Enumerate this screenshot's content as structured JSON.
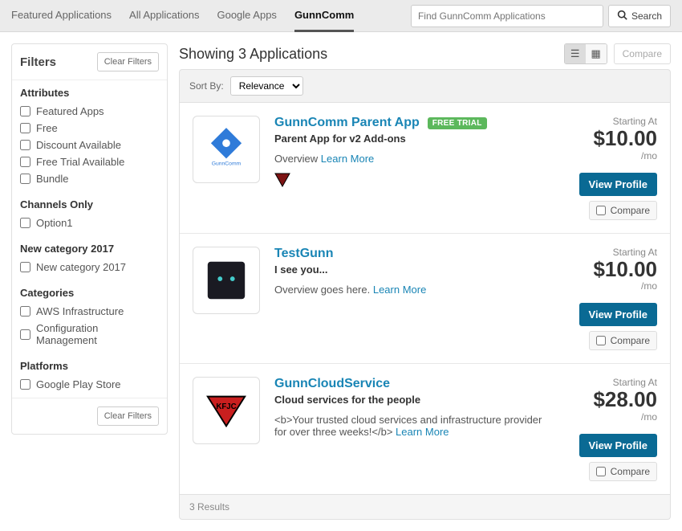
{
  "topnav": {
    "tabs": [
      "Featured Applications",
      "All Applications",
      "Google Apps",
      "GunnComm"
    ],
    "activeIndex": 3,
    "searchPlaceholder": "Find GunnComm Applications",
    "searchBtn": "Search"
  },
  "filters": {
    "title": "Filters",
    "clear": "Clear Filters",
    "groups": [
      {
        "title": "Attributes",
        "items": [
          "Featured Apps",
          "Free",
          "Discount Available",
          "Free Trial Available",
          "Bundle"
        ]
      },
      {
        "title": "Channels Only",
        "items": [
          "Option1"
        ]
      },
      {
        "title": "New category 2017",
        "items": [
          "New category 2017"
        ]
      },
      {
        "title": "Categories",
        "items": [
          "AWS Infrastructure",
          "Configuration Management"
        ]
      },
      {
        "title": "Platforms",
        "items": [
          "Google Play Store"
        ]
      }
    ]
  },
  "main": {
    "heading": "Showing 3 Applications",
    "compare": "Compare",
    "sortLabel": "Sort By:",
    "sortValue": "Relevance",
    "resultsFooter": "3 Results",
    "labels": {
      "starting": "Starting At",
      "viewProfile": "View Profile",
      "compare": "Compare",
      "learnMore": "Learn More"
    }
  },
  "apps": [
    {
      "name": "GunnComm Parent App",
      "freeTrial": "FREE TRIAL",
      "subtitle": "Parent App for v2 Add-ons",
      "overview": "Overview ",
      "price": "$10.00",
      "per": "/mo",
      "hasTriBadge": true
    },
    {
      "name": "TestGunn",
      "subtitle": "I see you...",
      "overview": "Overview goes here. ",
      "price": "$10.00",
      "per": "/mo"
    },
    {
      "name": "GunnCloudService",
      "subtitle": "Cloud services for the people",
      "overview": "<b>Your trusted cloud services and infrastructure provider for over three weeks!</b> ",
      "price": "$28.00",
      "per": "/mo"
    }
  ]
}
